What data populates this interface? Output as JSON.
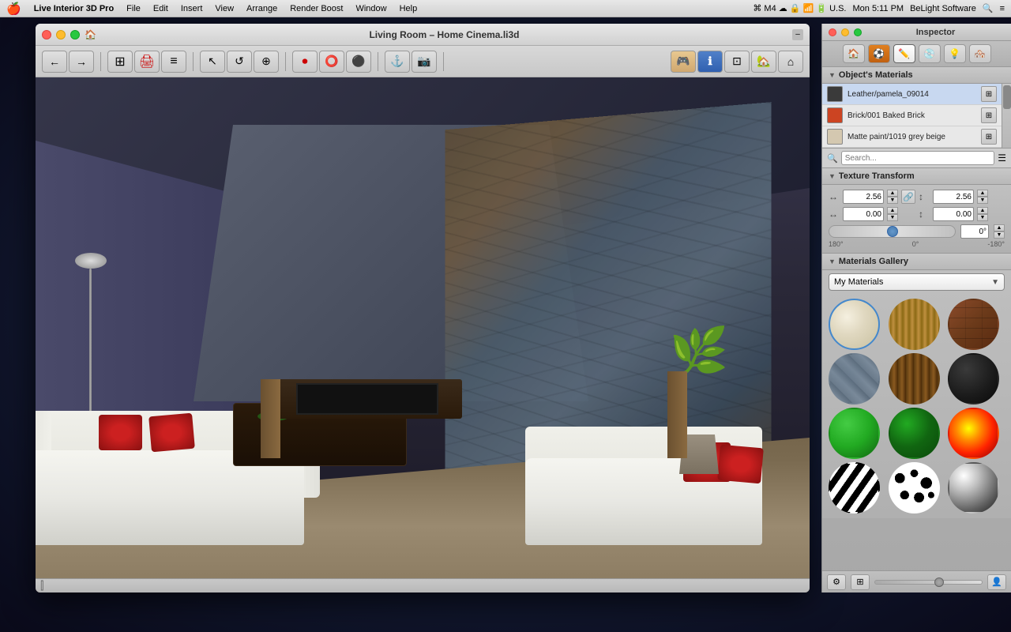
{
  "menubar": {
    "apple": "🍎",
    "items": [
      "Live Interior 3D Pro",
      "File",
      "Edit",
      "Insert",
      "View",
      "Arrange",
      "Render Boost",
      "Window",
      "Help"
    ],
    "right_items": [
      "Mon 5:11 PM",
      "BeLight Software"
    ]
  },
  "window": {
    "title": "Living Room – Home Cinema.li3d",
    "traffic_lights": [
      "close",
      "minimize",
      "maximize"
    ]
  },
  "inspector": {
    "title": "Inspector",
    "tabs": [
      "🏠",
      "⚽",
      "✏️",
      "💿",
      "💡",
      "🏠"
    ],
    "objects_materials_label": "Object's Materials",
    "materials": [
      {
        "name": "Leather/pamela_09014",
        "color": "#3a3a3a",
        "selected": true
      },
      {
        "name": "Brick/001 Baked Brick",
        "color": "#cc4422"
      },
      {
        "name": "Matte paint/1019 grey beige",
        "color": "#d4c8b0"
      }
    ],
    "texture_transform": {
      "label": "Texture Transform",
      "scale_x": "2.56",
      "scale_y": "2.56",
      "offset_x": "0.00",
      "offset_y": "0.00",
      "angle": "0°",
      "angle_min": "180°",
      "angle_mid": "0°",
      "angle_max": "-180°"
    },
    "gallery": {
      "label": "Materials Gallery",
      "dropdown_value": "My Materials",
      "items": [
        {
          "id": "cream",
          "class": "mat-cream"
        },
        {
          "id": "wood-light",
          "class": "mat-wood-light"
        },
        {
          "id": "brick",
          "class": "mat-brick"
        },
        {
          "id": "stone",
          "class": "mat-stone"
        },
        {
          "id": "wood-dark",
          "class": "mat-wood-dark"
        },
        {
          "id": "dark-sphere",
          "class": "mat-dark-sphere"
        },
        {
          "id": "green-bright",
          "class": "mat-green-bright"
        },
        {
          "id": "green-dark",
          "class": "mat-green-dark"
        },
        {
          "id": "fire",
          "class": "mat-fire"
        },
        {
          "id": "zebra",
          "class": "mat-zebra"
        },
        {
          "id": "spots",
          "class": "mat-spots"
        },
        {
          "id": "chrome",
          "class": "mat-chrome"
        }
      ]
    }
  },
  "toolbar": {
    "tools": [
      "←",
      "→",
      "⊞",
      "🖱️",
      "⊙",
      "◯",
      "⬤",
      "⚓",
      "📷",
      "🎮",
      "ℹ️",
      "⊡",
      "🏠",
      "⌂"
    ]
  }
}
